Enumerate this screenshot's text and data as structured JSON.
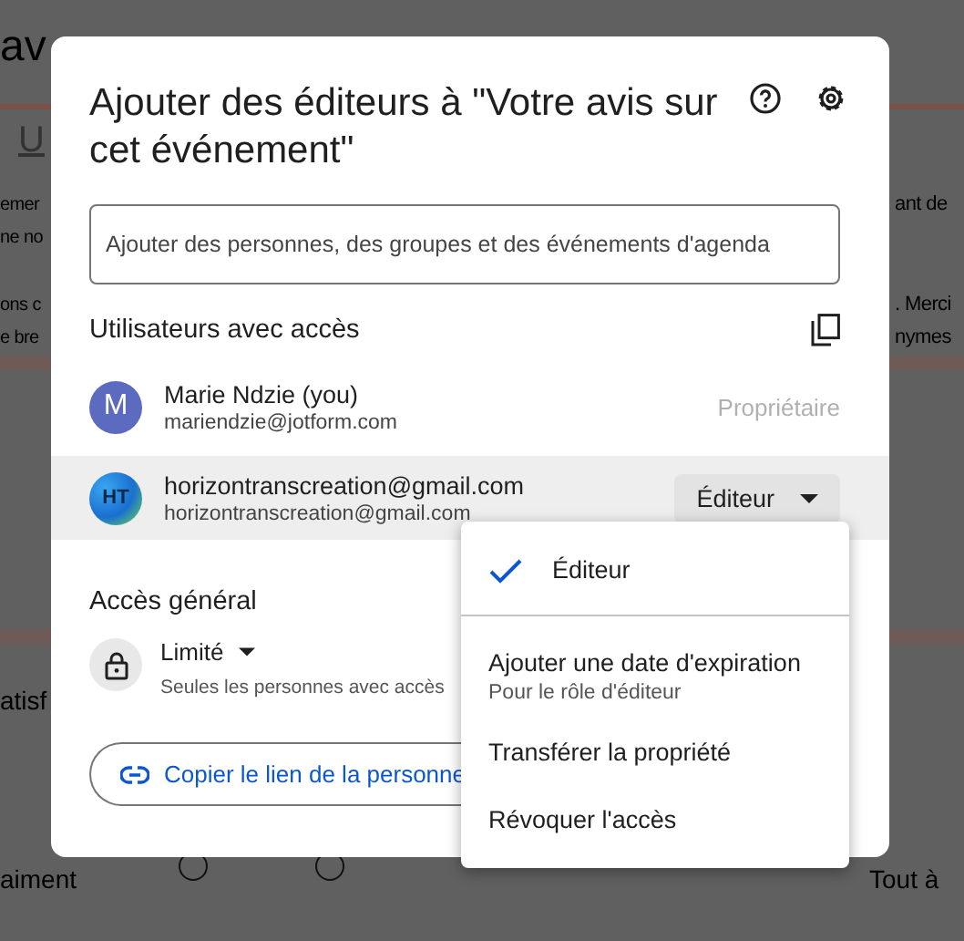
{
  "background": {
    "heading": "av",
    "tab": "U",
    "left_texts": [
      "emer",
      "ne no",
      "ons c",
      "e bre"
    ],
    "right_texts": [
      "ant de",
      ". Merci",
      "nymes"
    ],
    "question": "atisf",
    "scale_left": "aiment",
    "scale_right": "Tout à",
    "radios": [
      {
        "checked": false
      },
      {
        "checked": false
      }
    ]
  },
  "dialog": {
    "title": "Ajouter des éditeurs à \"Votre avis sur cet événement\"",
    "add_field": {
      "placeholder": "Ajouter des personnes, des groupes et des événements d'agenda"
    },
    "people_heading": "Utilisateurs avec accès",
    "people": [
      {
        "name": "Marie Ndzie (you)",
        "email": "mariendzie@jotform.com",
        "avatar": {
          "kind": "letter",
          "text": "M"
        },
        "role": "Propriétaire",
        "kind": "owner",
        "selected": false
      },
      {
        "name": "horizontranscreation@gmail.com",
        "email": "horizontranscreation@gmail.com",
        "avatar": {
          "kind": "image",
          "text": "HT"
        },
        "role": "Éditeur",
        "kind": "editable",
        "selected": true
      }
    ],
    "general_heading": "Accès général",
    "access": {
      "label": "Limité",
      "description": "Seules les personnes avec accès"
    },
    "copy_link": "Copier le lien de la personne"
  },
  "menu": {
    "items": [
      {
        "label": "Éditeur",
        "selected": true,
        "divider_after": true
      },
      {
        "label": "Ajouter une date d'expiration",
        "sublabel": "Pour le rôle d'éditeur",
        "selected": false,
        "divider_after": false
      },
      {
        "label": "Transférer la propriété",
        "selected": false,
        "divider_after": false
      },
      {
        "label": "Révoquer l'accès",
        "selected": false,
        "divider_after": false
      }
    ]
  }
}
